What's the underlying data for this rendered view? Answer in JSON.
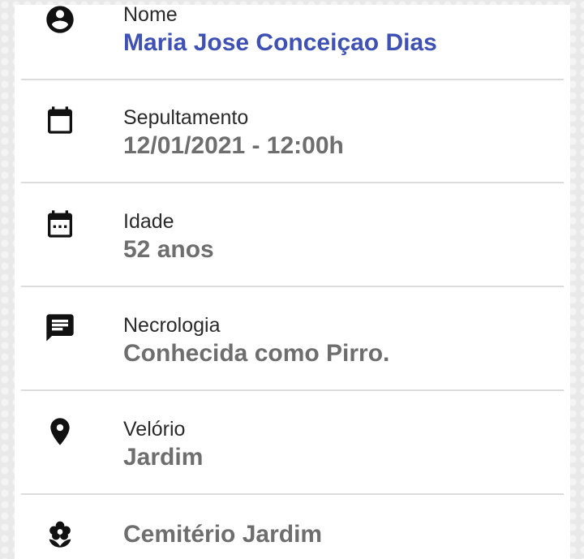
{
  "fields": [
    {
      "icon": "account-circle-icon",
      "label": "Nome",
      "value": "Maria Jose Conceiçao Dias"
    },
    {
      "icon": "calendar-icon",
      "label": "Sepultamento",
      "value": "12/01/2021 - 12:00h"
    },
    {
      "icon": "calendar-dots-icon",
      "label": "Idade",
      "value": "52 anos"
    },
    {
      "icon": "message-icon",
      "label": "Necrologia",
      "value": "Conhecida como Pirro."
    },
    {
      "icon": "location-pin-icon",
      "label": "Velório",
      "value": "Jardim"
    },
    {
      "icon": "flower-icon",
      "label": "",
      "value": "Cemitério Jardim"
    }
  ],
  "colors": {
    "accent": "#3f51b5",
    "label": "#2a2a2a",
    "value": "#6e6e6e",
    "divider": "#dcdcdc"
  }
}
